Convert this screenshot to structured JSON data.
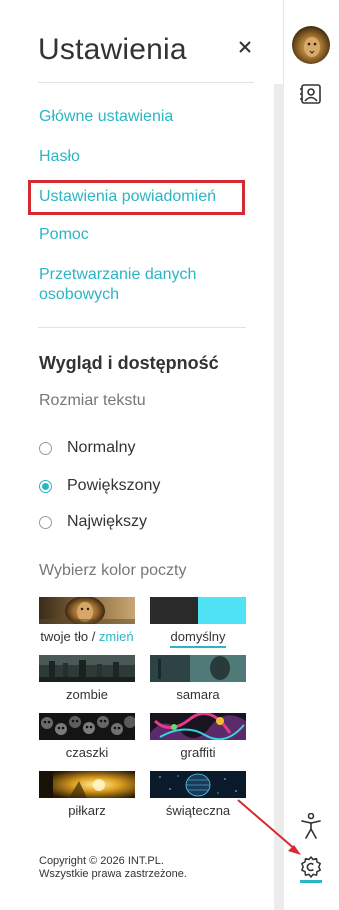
{
  "panel": {
    "title": "Ustawienia",
    "close_label": "×"
  },
  "nav": {
    "main_settings": "Główne ustawienia",
    "password": "Hasło",
    "notifications": "Ustawienia powiadomień",
    "help": "Pomoc",
    "data_processing_line1": "Przetwarzanie danych",
    "data_processing_line2": "osobowych"
  },
  "appearance": {
    "title": "Wygląd i dostępność",
    "text_size_label": "Rozmiar tekstu",
    "options": [
      "Normalny",
      "Powiększony",
      "Największy"
    ],
    "selected": "Powiększony",
    "color_label": "Wybierz kolor poczty"
  },
  "themes": {
    "own_background": "twoje tło",
    "own_background_sep": " / ",
    "own_background_change": "zmień",
    "default": "domyślny",
    "zombie": "zombie",
    "samara": "samara",
    "skulls": "czaszki",
    "graffiti": "graffiti",
    "footballer": "piłkarz",
    "festive": "świąteczna",
    "default_colors": {
      "left": "#2a2a2a",
      "right": "#4fe3f5"
    },
    "accent_color": "#2bb5c5"
  },
  "footer": {
    "copyright": "Copyright © 2026 INT.PL.",
    "rights": "Wszystkie prawa zastrzeżone."
  },
  "rail": {
    "avatar_icon": "lion-avatar",
    "contacts_icon": "contact-book-icon",
    "accessibility_icon": "accessibility-icon",
    "settings_icon": "gear-icon"
  }
}
